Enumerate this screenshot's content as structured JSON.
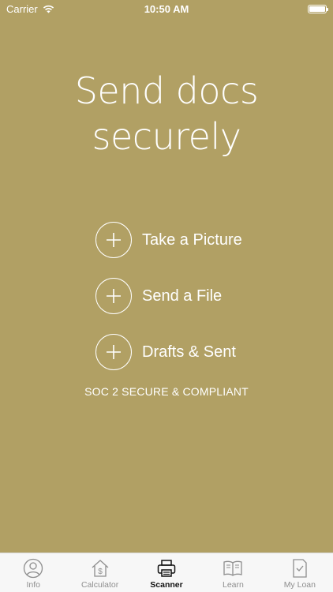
{
  "status_bar": {
    "carrier": "Carrier",
    "time": "10:50 AM"
  },
  "headline": {
    "line1": "Send docs",
    "line2": "securely"
  },
  "actions": [
    {
      "label": "Take a Picture",
      "icon": "plus-icon"
    },
    {
      "label": "Send a File",
      "icon": "plus-icon"
    },
    {
      "label": "Drafts & Sent",
      "icon": "plus-icon"
    }
  ],
  "compliance_text": "SOC 2 SECURE & COMPLIANT",
  "tabbar": {
    "active": "Scanner",
    "tabs": [
      {
        "label": "Info",
        "icon": "person-icon"
      },
      {
        "label": "Calculator",
        "icon": "house-dollar-icon"
      },
      {
        "label": "Scanner",
        "icon": "scanner-icon"
      },
      {
        "label": "Learn",
        "icon": "book-icon"
      },
      {
        "label": "My Loan",
        "icon": "document-check-icon"
      }
    ]
  },
  "colors": {
    "background": "#b1a064",
    "tabbar": "#f7f7f7",
    "tab_inactive": "#8e8e8e",
    "tab_active": "#111111"
  }
}
